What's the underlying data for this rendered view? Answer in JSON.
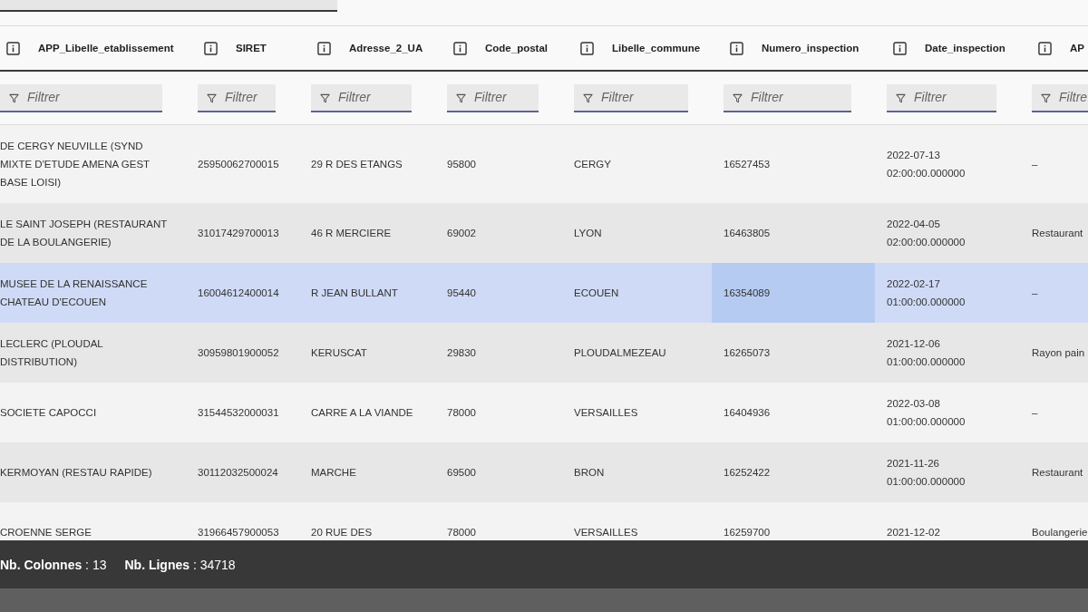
{
  "toolbar": {
    "select": {
      "kind": "dropdown"
    }
  },
  "table": {
    "columns": [
      {
        "label": "APP_Libelle_etablissement",
        "filter_placeholder": "Filtrer"
      },
      {
        "label": "SIRET",
        "filter_placeholder": "Filtrer"
      },
      {
        "label": "Adresse_2_UA",
        "filter_placeholder": "Filtrer"
      },
      {
        "label": "Code_postal",
        "filter_placeholder": "Filtrer"
      },
      {
        "label": "Libelle_commune",
        "filter_placeholder": "Filtrer"
      },
      {
        "label": "Numero_inspection",
        "filter_placeholder": "Filtrer"
      },
      {
        "label": "Date_inspection",
        "filter_placeholder": "Filtrer"
      },
      {
        "label": "AP",
        "filter_placeholder": "Filtre"
      }
    ],
    "rows": [
      {
        "selected": false,
        "cells": [
          {
            "text": "DE CERGY NEUVILLE (SYND MIXTE D'ETUDE AMENA GEST BASE LOISI)",
            "focused": false
          },
          {
            "text": "25950062700015",
            "focused": false
          },
          {
            "text": "29 R DES ETANGS",
            "focused": false
          },
          {
            "text": "95800",
            "focused": false
          },
          {
            "text": "CERGY",
            "focused": false
          },
          {
            "text": "16527453",
            "focused": false
          },
          {
            "text": "2022-07-13 02:00:00.000000",
            "focused": false
          },
          {
            "text": "–",
            "focused": false
          }
        ]
      },
      {
        "selected": false,
        "cells": [
          {
            "text": "LE SAINT JOSEPH (RESTAURANT DE LA BOULANGERIE)",
            "focused": false
          },
          {
            "text": "31017429700013",
            "focused": false
          },
          {
            "text": "46 R MERCIERE",
            "focused": false
          },
          {
            "text": "69002",
            "focused": false
          },
          {
            "text": "LYON",
            "focused": false
          },
          {
            "text": "16463805",
            "focused": false
          },
          {
            "text": "2022-04-05 02:00:00.000000",
            "focused": false
          },
          {
            "text": "Restaurant",
            "focused": false
          }
        ]
      },
      {
        "selected": true,
        "cells": [
          {
            "text": "MUSEE DE LA RENAISSANCE CHATEAU D'ECOUEN",
            "focused": false
          },
          {
            "text": "16004612400014",
            "focused": false
          },
          {
            "text": "R JEAN BULLANT",
            "focused": false
          },
          {
            "text": "95440",
            "focused": false
          },
          {
            "text": "ECOUEN",
            "focused": false
          },
          {
            "text": "16354089",
            "focused": true
          },
          {
            "text": "2022-02-17 01:00:00.000000",
            "focused": false
          },
          {
            "text": "–",
            "focused": false
          }
        ]
      },
      {
        "selected": false,
        "cells": [
          {
            "text": "LECLERC (PLOUDAL DISTRIBUTION)",
            "focused": false
          },
          {
            "text": "30959801900052",
            "focused": false
          },
          {
            "text": "KERUSCAT",
            "focused": false
          },
          {
            "text": "29830",
            "focused": false
          },
          {
            "text": "PLOUDALMEZEAU",
            "focused": false
          },
          {
            "text": "16265073",
            "focused": false
          },
          {
            "text": "2021-12-06 01:00:00.000000",
            "focused": false
          },
          {
            "text": "Rayon pain",
            "focused": false
          }
        ]
      },
      {
        "selected": false,
        "cells": [
          {
            "text": "SOCIETE CAPOCCI",
            "focused": false
          },
          {
            "text": "31544532000031",
            "focused": false
          },
          {
            "text": "CARRE A LA VIANDE",
            "focused": false
          },
          {
            "text": "78000",
            "focused": false
          },
          {
            "text": "VERSAILLES",
            "focused": false
          },
          {
            "text": "16404936",
            "focused": false
          },
          {
            "text": "2022-03-08 01:00:00.000000",
            "focused": false
          },
          {
            "text": "–",
            "focused": false
          }
        ]
      },
      {
        "selected": false,
        "cells": [
          {
            "text": "KERMOYAN (RESTAU RAPIDE)",
            "focused": false
          },
          {
            "text": "30112032500024",
            "focused": false
          },
          {
            "text": "MARCHE",
            "focused": false
          },
          {
            "text": "69500",
            "focused": false
          },
          {
            "text": "BRON",
            "focused": false
          },
          {
            "text": "16252422",
            "focused": false
          },
          {
            "text": "2021-11-26 01:00:00.000000",
            "focused": false
          },
          {
            "text": "Restaurant",
            "focused": false
          }
        ]
      },
      {
        "selected": false,
        "cells": [
          {
            "text": "CROENNE SERGE",
            "focused": false
          },
          {
            "text": "31966457900053",
            "focused": false
          },
          {
            "text": "20 RUE DES",
            "focused": false
          },
          {
            "text": "78000",
            "focused": false
          },
          {
            "text": "VERSAILLES",
            "focused": false
          },
          {
            "text": "16259700",
            "focused": false
          },
          {
            "text": "2021-12-02",
            "focused": false
          },
          {
            "text": "Boulangerie",
            "focused": false
          }
        ]
      }
    ]
  },
  "status_bar": [
    "**Nb. Colonnes** : 13",
    "**Nb. Lignes** : 34718"
  ]
}
